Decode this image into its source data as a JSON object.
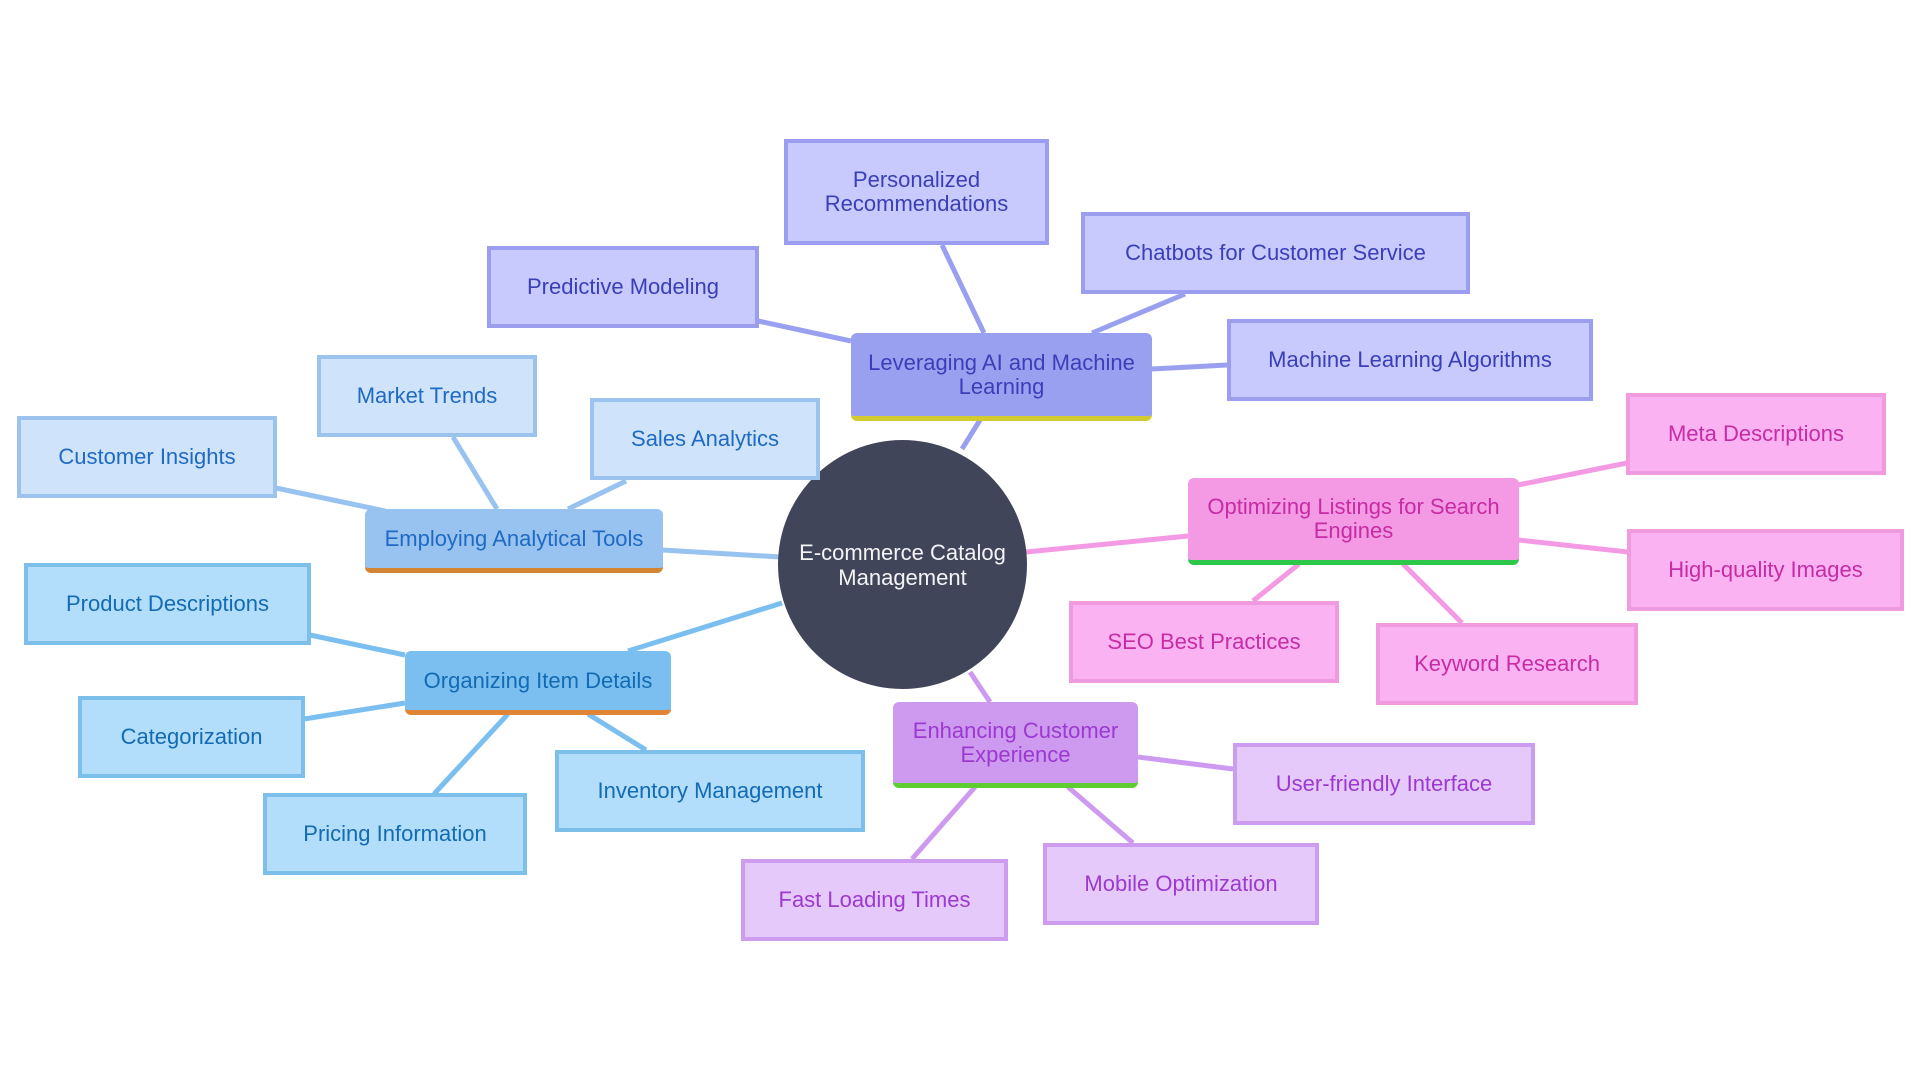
{
  "diagram": {
    "type": "mindmap",
    "root": "E-commerce Catalog Management",
    "branches": [
      {
        "id": "ai",
        "label": "Leveraging AI and Machine Learning",
        "fill": "#9aa0f0",
        "underline": "#d4cb30",
        "children": [
          "Personalized Recommendations",
          "Chatbots for Customer Service",
          "Predictive Modeling",
          "Machine Learning Algorithms"
        ]
      },
      {
        "id": "analytics",
        "label": "Employing Analytical Tools",
        "fill": "#98c2ef",
        "underline": "#d38534",
        "children": [
          "Market Trends",
          "Customer Insights",
          "Sales Analytics"
        ]
      },
      {
        "id": "organizing",
        "label": "Organizing Item Details",
        "fill": "#7bbff0",
        "underline": "#e08535",
        "children": [
          "Product Descriptions",
          "Categorization",
          "Pricing Information",
          "Inventory Management"
        ]
      },
      {
        "id": "seo",
        "label": "Optimizing Listings for Search Engines",
        "fill": "#f49ae4",
        "underline": "#2dc84a",
        "children": [
          "Meta Descriptions",
          "High-quality Images",
          "SEO Best Practices",
          "Keyword Research"
        ]
      },
      {
        "id": "ux",
        "label": "Enhancing Customer Experience",
        "fill": "#cd9af0",
        "underline": "#5fcc32",
        "children": [
          "User-friendly Interface",
          "Fast Loading Times",
          "Mobile Optimization"
        ]
      }
    ]
  }
}
